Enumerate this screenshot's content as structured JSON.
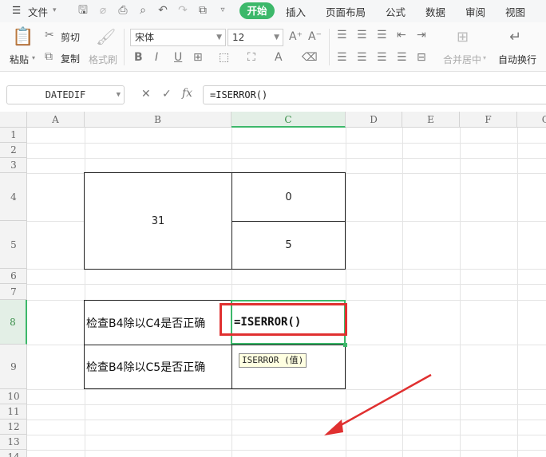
{
  "menu": {
    "file_label": "文件",
    "tabs": [
      "开始",
      "插入",
      "页面布局",
      "公式",
      "数据",
      "审阅",
      "视图"
    ]
  },
  "ribbon": {
    "paste_label": "粘贴",
    "cut_label": "剪切",
    "copy_label": "复制",
    "format_painter_label": "格式刷",
    "font_name": "宋体",
    "font_size": "12",
    "merge_label": "合并居中",
    "wrap_label": "自动换行"
  },
  "formula_bar": {
    "name_box": "DATEDIF",
    "fx_label": "fx",
    "formula": "=ISERROR()"
  },
  "grid": {
    "columns": [
      "A",
      "B",
      "C",
      "D",
      "E",
      "F",
      "G"
    ],
    "selected_column": "C",
    "rows": [
      "1",
      "2",
      "3",
      "4",
      "5",
      "6",
      "7",
      "8",
      "9",
      "10",
      "11",
      "12",
      "13",
      "14"
    ],
    "selected_row": "8",
    "cells": {
      "B4": "31",
      "C4": "0",
      "C5": "5",
      "B8": "检查B4除以C4是否正确",
      "C8": "=ISERROR()",
      "B9": "检查B4除以C5是否正确"
    },
    "tooltip": "ISERROR (值)"
  },
  "colors": {
    "accent": "#3cb86a",
    "annotation": "#e03030"
  }
}
